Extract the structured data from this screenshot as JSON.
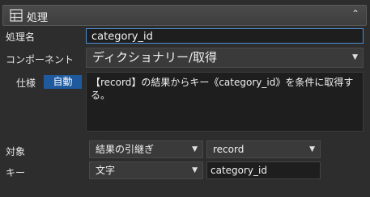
{
  "header": {
    "title": "処理",
    "icon": "grid-icon",
    "collapse_icon": "chevron-up-icon"
  },
  "fields": {
    "name_label": "処理名",
    "name_value": "category_id",
    "component_label": "コンポーネント",
    "component_value": "ディクショナリー/取得",
    "spec_label": "仕様",
    "spec_mode": "自動",
    "spec_text": "【record】の結果からキー《category_id》を条件に取得する。",
    "target_label": "対象",
    "target_source": "結果の引継ぎ",
    "target_value": "record",
    "key_label": "キー",
    "key_type": "文字",
    "key_value": "category_id"
  },
  "colors": {
    "accent": "#1f5a9e",
    "focus_border": "#4d90d6",
    "background": "#2d2d2d"
  }
}
